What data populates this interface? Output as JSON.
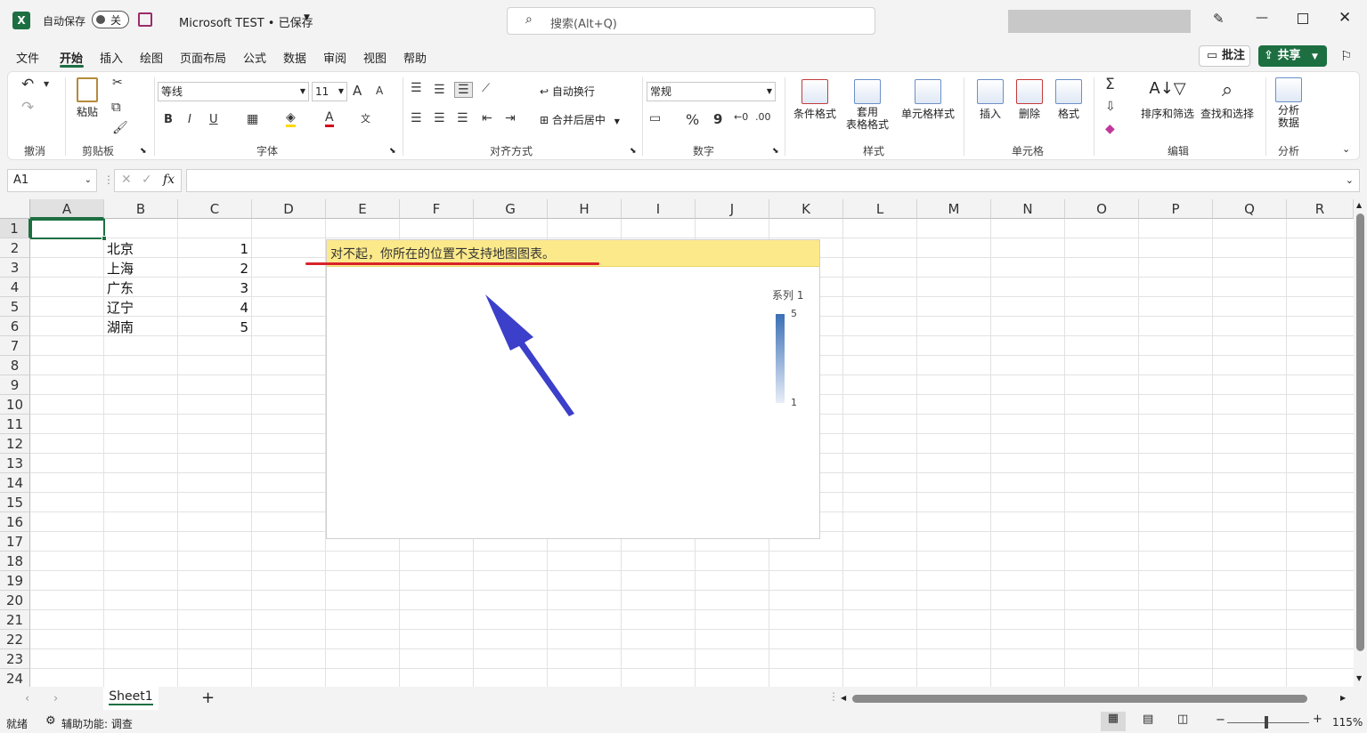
{
  "titlebar": {
    "autosave_label": "自动保存",
    "autosave_state": "关",
    "doc_title": "Microsoft TEST • 已保存",
    "search_placeholder": "搜索(Alt+Q)"
  },
  "menu": {
    "tabs": [
      "文件",
      "开始",
      "插入",
      "绘图",
      "页面布局",
      "公式",
      "数据",
      "审阅",
      "视图",
      "帮助"
    ],
    "active": "开始",
    "comments": "批注",
    "share": "共享"
  },
  "ribbon": {
    "undo_group": "撤消",
    "clipboard": {
      "paste": "粘贴",
      "group": "剪贴板"
    },
    "font": {
      "name": "等线",
      "size": "11",
      "group": "字体",
      "bold": "B",
      "italic": "I",
      "underline": "U",
      "grow": "A",
      "shrink": "A"
    },
    "alignment": {
      "wrap": "自动换行",
      "merge": "合并后居中",
      "group": "对齐方式"
    },
    "number": {
      "format": "常规",
      "percent": "%",
      "comma": "9",
      "group": "数字"
    },
    "styles": {
      "conditional": "条件格式",
      "table_line1": "套用",
      "table_line2": "表格格式",
      "cell_styles": "单元格样式",
      "group": "样式"
    },
    "cells": {
      "insert": "插入",
      "delete": "删除",
      "format": "格式",
      "group": "单元格"
    },
    "editing": {
      "sort": "排序和筛选",
      "find": "查找和选择",
      "group": "编辑"
    },
    "analysis": {
      "line1": "分析",
      "line2": "数据",
      "group": "分析"
    }
  },
  "formula_bar": {
    "name_box": "A1",
    "fx": "fx",
    "content": ""
  },
  "columns": [
    "A",
    "B",
    "C",
    "D",
    "E",
    "F",
    "G",
    "H",
    "I",
    "J",
    "K",
    "L",
    "M",
    "N",
    "O",
    "P",
    "Q",
    "R"
  ],
  "rows": [
    "1",
    "2",
    "3",
    "4",
    "5",
    "6",
    "7",
    "8",
    "9",
    "10",
    "11",
    "12",
    "13",
    "14",
    "15",
    "16",
    "17",
    "18",
    "19",
    "20",
    "21",
    "22",
    "23",
    "24"
  ],
  "cells": [
    {
      "label": "北京",
      "value": "1"
    },
    {
      "label": "上海",
      "value": "2"
    },
    {
      "label": "广东",
      "value": "3"
    },
    {
      "label": "辽宁",
      "value": "4"
    },
    {
      "label": "湖南",
      "value": "5"
    }
  ],
  "chart": {
    "warning": "对不起，你所在的位置不支持地图图表。",
    "legend_title": "系列 1",
    "legend_max": "5",
    "legend_min": "1",
    "accent": "#3a6fb5",
    "warning_bg": "#fce98a",
    "arrow_color": "#3b3fc9"
  },
  "sheets": {
    "active": "Sheet1",
    "add": "+"
  },
  "status": {
    "ready": "就绪",
    "accessibility": "辅助功能: 调查",
    "zoom": "115%"
  }
}
